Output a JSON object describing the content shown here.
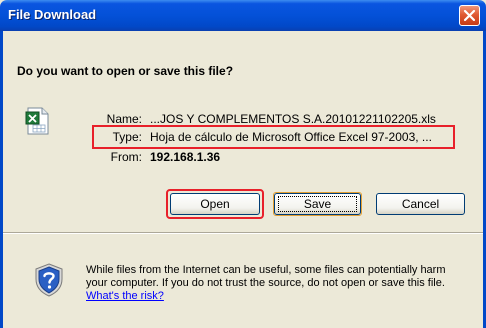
{
  "titlebar": {
    "title": "File Download"
  },
  "dialog": {
    "question": "Do you want to open or save this file?",
    "name_label": "Name:",
    "name_value": "...JOS Y COMPLEMENTOS  S.A.20101221102205.xls",
    "type_label": "Type:",
    "type_value": "Hoja de cálculo de Microsoft Office Excel 97-2003, ...",
    "from_label": "From:",
    "from_value": "192.168.1.36"
  },
  "buttons": {
    "open": "Open",
    "save": "Save",
    "cancel": "Cancel"
  },
  "warning": {
    "text": "While files from the Internet can be useful, some files can potentially harm your computer. If you do not trust the source, do not open or save this file. ",
    "link": "What's the risk?"
  },
  "colors": {
    "title_blue": "#0451d8",
    "dialog_bg": "#ece9d8",
    "highlight_red": "#e8202a",
    "link_blue": "#0000ff"
  },
  "icons": [
    "close-icon",
    "excel-file-icon",
    "security-shield-icon"
  ]
}
